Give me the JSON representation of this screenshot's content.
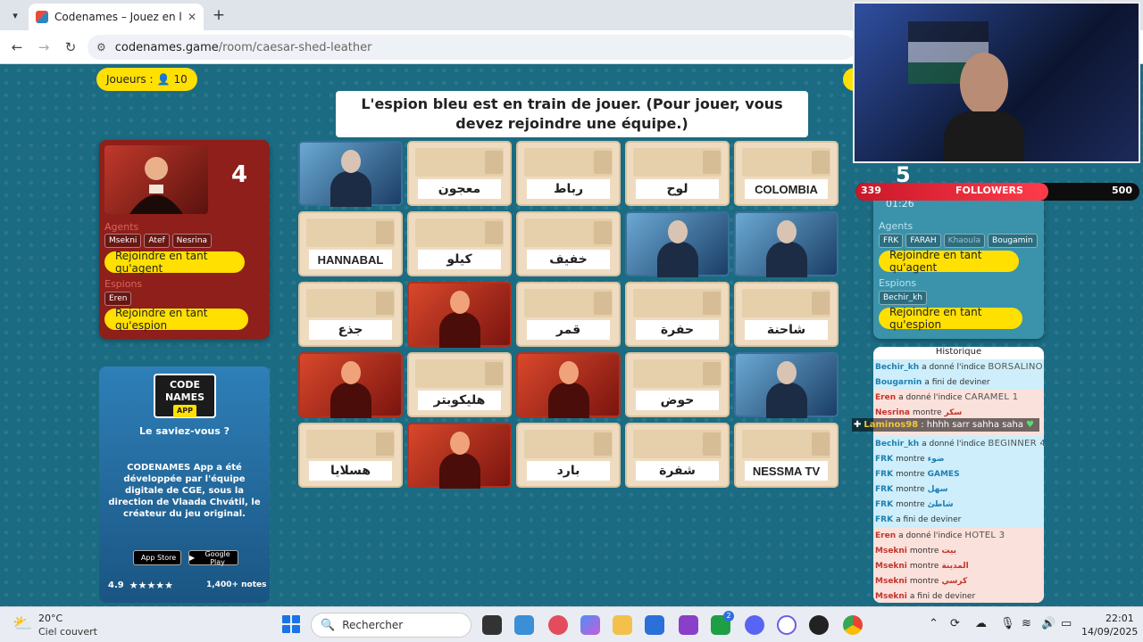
{
  "browser": {
    "tab_title": "Codenames – Jouez en ligne av",
    "url_domain": "codenames.game",
    "url_path": "/room/caesar-shed-leather"
  },
  "game": {
    "players_label": "Joueurs :",
    "players_count": "10",
    "banner": "L'espion bleu est en train de jouer. (Pour jouer, vous devez rejoindre une équipe.)"
  },
  "red_team": {
    "score": "4",
    "agents_label": "Agents",
    "agents": [
      "Msekni",
      "Atef",
      "Nesrina"
    ],
    "join_agent": "Rejoindre en tant qu'agent",
    "spies_label": "Espions",
    "spies": [
      "Eren"
    ],
    "join_spy": "Rejoindre en tant qu'espion"
  },
  "blue_team": {
    "score": "5",
    "timer": "01:26",
    "agents_label": "Agents",
    "agents": [
      "FRK",
      "FARAH",
      "Khaoula",
      "Bougamin"
    ],
    "join_agent": "Rejoindre en tant qu'agent",
    "spies_label": "Espions",
    "spies": [
      "Bechir_kh"
    ],
    "join_spy": "Rejoindre en tant qu'espion"
  },
  "promo": {
    "logo_line1": "CODE",
    "logo_line2": "NAMES",
    "logo_app": "APP",
    "question": "Le saviez-vous ?",
    "text": "CODENAMES App a été développée par l'équipe digitale de CGE, sous la direction de Vlaada Chvátil, le créateur du jeu original.",
    "app_store": "App Store",
    "google_play": "Google Play",
    "rating": "4.9",
    "notes": "1,400+ notes"
  },
  "board": [
    {
      "type": "agent-blue",
      "word": ""
    },
    {
      "type": "word",
      "word": "معجون"
    },
    {
      "type": "word",
      "word": "رباط"
    },
    {
      "type": "word",
      "word": "لوح"
    },
    {
      "type": "word",
      "word": "COLOMBIA"
    },
    {
      "type": "word",
      "word": "HANNABAL"
    },
    {
      "type": "word",
      "word": "كيلو"
    },
    {
      "type": "word",
      "word": "خفيف"
    },
    {
      "type": "agent-blue",
      "word": ""
    },
    {
      "type": "agent-blue",
      "word": ""
    },
    {
      "type": "word",
      "word": "جذع"
    },
    {
      "type": "agent-red",
      "word": ""
    },
    {
      "type": "word",
      "word": "قمر"
    },
    {
      "type": "word",
      "word": "حفرة"
    },
    {
      "type": "word",
      "word": "شاحنة"
    },
    {
      "type": "agent-red",
      "word": ""
    },
    {
      "type": "word",
      "word": "هليكوبتر"
    },
    {
      "type": "agent-red",
      "word": ""
    },
    {
      "type": "word",
      "word": "حوض"
    },
    {
      "type": "agent-blue",
      "word": ""
    },
    {
      "type": "word",
      "word": "هسلايا"
    },
    {
      "type": "agent-red",
      "word": ""
    },
    {
      "type": "word",
      "word": "بارد"
    },
    {
      "type": "word",
      "word": "شفرة"
    },
    {
      "type": "word",
      "word": "NESSMA TV"
    }
  ],
  "stream": {
    "followers_current": "339",
    "followers_label": "FOLLOWERS",
    "followers_goal": "500",
    "followers_progress": 0.678,
    "chat_user": "Laminos98",
    "chat_message": ": hhhh sarr sahha saha"
  },
  "history": {
    "title": "Historique",
    "rows": [
      {
        "team": "blue",
        "name": "Bechir_kh",
        "verb": "a donné l'indice",
        "hint": "BORSALINO 2",
        "word": ""
      },
      {
        "team": "blue",
        "name": "Bougarnin",
        "verb": "a fini de deviner",
        "hint": "",
        "word": ""
      },
      {
        "team": "red",
        "name": "Eren",
        "verb": "a donné l'indice",
        "hint": "CARAMEL 1",
        "word": ""
      },
      {
        "team": "red",
        "name": "Nesrina",
        "verb": "montre",
        "hint": "",
        "word": "سكر"
      },
      {
        "team": "red",
        "name": "",
        "verb": "",
        "hint": "",
        "word": ""
      },
      {
        "team": "blue",
        "name": "Bechir_kh",
        "verb": "a donné l'indice",
        "hint": "BEGINNER 4",
        "word": ""
      },
      {
        "team": "blue",
        "name": "FRK",
        "verb": "montre",
        "hint": "",
        "word": "ضوء"
      },
      {
        "team": "blue",
        "name": "FRK",
        "verb": "montre",
        "hint": "",
        "word": "GAMES"
      },
      {
        "team": "blue",
        "name": "FRK",
        "verb": "montre",
        "hint": "",
        "word": "سهل"
      },
      {
        "team": "blue",
        "name": "FRK",
        "verb": "montre",
        "hint": "",
        "word": "شاطئ"
      },
      {
        "team": "blue",
        "name": "FRK",
        "verb": "a fini de deviner",
        "hint": "",
        "word": ""
      },
      {
        "team": "red",
        "name": "Eren",
        "verb": "a donné l'indice",
        "hint": "HOTEL 3",
        "word": ""
      },
      {
        "team": "red",
        "name": "Msekni",
        "verb": "montre",
        "hint": "",
        "word": "بيت"
      },
      {
        "team": "red",
        "name": "Msekni",
        "verb": "montre",
        "hint": "",
        "word": "المدينة"
      },
      {
        "team": "red",
        "name": "Msekni",
        "verb": "montre",
        "hint": "",
        "word": "كرسي"
      },
      {
        "team": "red",
        "name": "Msekni",
        "verb": "a fini de deviner",
        "hint": "",
        "word": ""
      }
    ]
  },
  "taskbar": {
    "temperature": "20°C",
    "condition": "Ciel couvert",
    "search_placeholder": "Rechercher",
    "time": "22:01",
    "date": "14/09/2025",
    "badge_count": "2"
  },
  "colors": {
    "red_team": "#8e1f1a",
    "blue_team": "#3a93ab",
    "accent_yellow": "#ffe000",
    "board_bg": "#1b6b82"
  }
}
